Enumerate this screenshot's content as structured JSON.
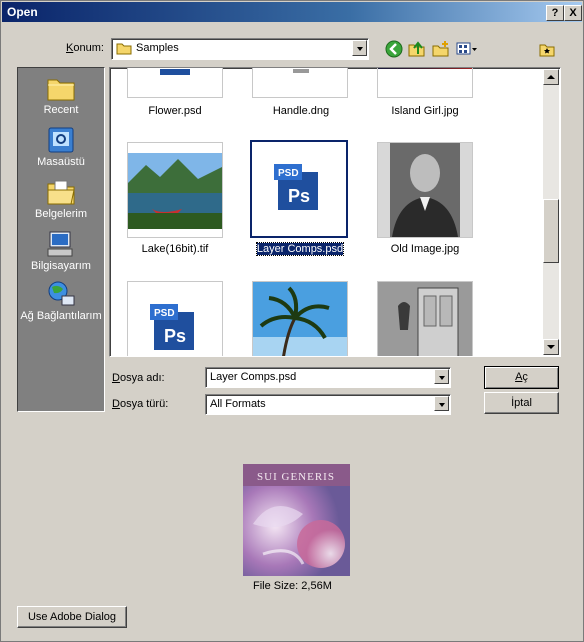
{
  "window": {
    "title": "Open",
    "help_label": "?",
    "close_label": "X"
  },
  "location": {
    "label_prefix": "",
    "label_underlined": "K",
    "label_rest": "onum:",
    "value": "Samples"
  },
  "toolbar": {
    "icons": [
      "back-icon",
      "up-folder-icon",
      "new-folder-icon",
      "view-menu-icon"
    ],
    "extra_icon": "favorites-icon"
  },
  "places": [
    {
      "label": "Recent",
      "icon": "recent-folder-icon"
    },
    {
      "label": "Masaüstü",
      "icon": "desktop-icon"
    },
    {
      "label": "Belgelerim",
      "icon": "documents-icon"
    },
    {
      "label": "Bilgisayarım",
      "icon": "computer-icon"
    },
    {
      "label": "Ağ Bağlantılarım",
      "icon": "network-icon"
    }
  ],
  "files": [
    {
      "name": "Flower.psd",
      "kind": "psd"
    },
    {
      "name": "Handle.dng",
      "kind": "image"
    },
    {
      "name": "Island Girl.jpg",
      "kind": "image"
    },
    {
      "name": "Lake(16bit).tif",
      "kind": "image"
    },
    {
      "name": "Layer Comps.psd",
      "kind": "psd",
      "selected": true
    },
    {
      "name": "Old Image.jpg",
      "kind": "image"
    },
    {
      "name": "",
      "kind": "psd"
    },
    {
      "name": "",
      "kind": "image"
    },
    {
      "name": "",
      "kind": "image"
    }
  ],
  "filename": {
    "label_underlined": "D",
    "label_rest": "osya adı:",
    "value": "Layer Comps.psd"
  },
  "filetype": {
    "label_underlined": "D",
    "label_rest": "osya türü:",
    "value": "All Formats"
  },
  "buttons": {
    "open_underlined": "A",
    "open_rest": "ç",
    "cancel": "İptal",
    "adobe": "Use Adobe Dialog"
  },
  "preview": {
    "image_title": "SUI GENERIS",
    "filesize": "File Size: 2,56M"
  },
  "psd_badge": {
    "top": "PSD",
    "bottom": "Ps"
  },
  "colors": {
    "titlebar": "#0a246a",
    "selection": "#0a246a",
    "psd_blue": "#1f4f9e"
  }
}
